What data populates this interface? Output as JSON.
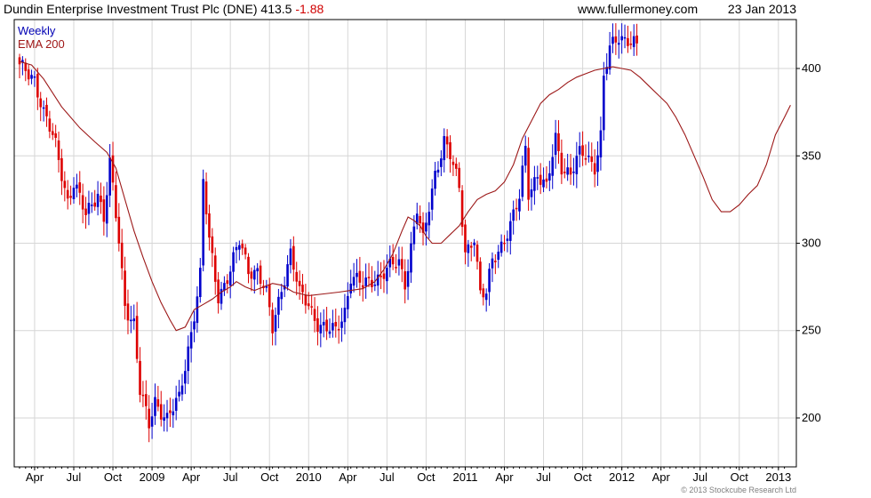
{
  "header": {
    "title_main": "Dundin Enterprise Investment Trust Plc (DNE) 413.5 ",
    "change": "-1.88",
    "site": "www.fullermoney.com",
    "date": "23 Jan 2013"
  },
  "footer": {
    "copyright": "© 2013 Stockcube Research Ltd"
  },
  "chart_data": {
    "type": "candlestick",
    "ylim": [
      172,
      428
    ],
    "y_ticks": [
      200,
      250,
      300,
      350,
      400
    ],
    "y_tick_labels": [
      "200",
      "250",
      "300",
      "350",
      "400"
    ],
    "x_tick_labels": [
      "Apr",
      "Jul",
      "Oct",
      "2009",
      "Apr",
      "Jul",
      "Oct",
      "2010",
      "Apr",
      "Jul",
      "Oct",
      "2011",
      "Apr",
      "Jul",
      "Oct",
      "2012",
      "Apr",
      "Jul",
      "Oct",
      "2013"
    ],
    "x_tick_weeks": [
      5,
      18,
      31,
      44,
      57,
      70,
      83,
      96,
      109,
      122,
      135,
      148,
      161,
      174,
      187,
      200,
      213,
      226,
      239,
      252
    ],
    "total_weeks": 256,
    "grid": true,
    "legend": {
      "position": "top-left",
      "entries": [
        "Weekly",
        "EMA 200"
      ]
    },
    "colors": {
      "up": "#0000cc",
      "down": "#dd0000",
      "ema": "#9c1818",
      "grid": "#d6d6d6"
    },
    "series": [
      {
        "name": "Weekly",
        "kind": "close_anchors",
        "points": [
          [
            0,
            400
          ],
          [
            5,
            395
          ],
          [
            8,
            375
          ],
          [
            12,
            355
          ],
          [
            16,
            325
          ],
          [
            18,
            335
          ],
          [
            22,
            315
          ],
          [
            26,
            330
          ],
          [
            28,
            315
          ],
          [
            30,
            345
          ],
          [
            33,
            300
          ],
          [
            35,
            265
          ],
          [
            38,
            255
          ],
          [
            40,
            215
          ],
          [
            43,
            195
          ],
          [
            45,
            210
          ],
          [
            49,
            200
          ],
          [
            53,
            210
          ],
          [
            57,
            250
          ],
          [
            60,
            282
          ],
          [
            61,
            335
          ],
          [
            63,
            300
          ],
          [
            66,
            270
          ],
          [
            70,
            285
          ],
          [
            73,
            300
          ],
          [
            76,
            285
          ],
          [
            79,
            285
          ],
          [
            82,
            270
          ],
          [
            84,
            250
          ],
          [
            87,
            275
          ],
          [
            90,
            295
          ],
          [
            93,
            270
          ],
          [
            96,
            265
          ],
          [
            99,
            255
          ],
          [
            102,
            250
          ],
          [
            105,
            249
          ],
          [
            108,
            262
          ],
          [
            110,
            282
          ],
          [
            114,
            275
          ],
          [
            118,
            280
          ],
          [
            122,
            285
          ],
          [
            126,
            288
          ],
          [
            128,
            278
          ],
          [
            132,
            320
          ],
          [
            134,
            300
          ],
          [
            138,
            340
          ],
          [
            141,
            360
          ],
          [
            143,
            350
          ],
          [
            146,
            330
          ],
          [
            148,
            295
          ],
          [
            151,
            305
          ],
          [
            153,
            270
          ],
          [
            155,
            270
          ],
          [
            157,
            290
          ],
          [
            160,
            300
          ],
          [
            163,
            310
          ],
          [
            166,
            325
          ],
          [
            168,
            355
          ],
          [
            169,
            330
          ],
          [
            172,
            340
          ],
          [
            175,
            330
          ],
          [
            178,
            360
          ],
          [
            180,
            345
          ],
          [
            183,
            340
          ],
          [
            186,
            350
          ],
          [
            188,
            350
          ],
          [
            191,
            345
          ],
          [
            193,
            362
          ],
          [
            194,
            395
          ],
          [
            196,
            410
          ],
          [
            199,
            418
          ],
          [
            202,
            418
          ],
          [
            204,
            415
          ],
          [
            205,
            412
          ]
        ]
      },
      {
        "name": "EMA 200",
        "kind": "line",
        "points": [
          [
            0,
            404
          ],
          [
            4,
            402
          ],
          [
            8,
            394
          ],
          [
            14,
            378
          ],
          [
            20,
            366
          ],
          [
            25,
            358
          ],
          [
            29,
            352
          ],
          [
            32,
            343
          ],
          [
            35,
            325
          ],
          [
            38,
            307
          ],
          [
            41,
            292
          ],
          [
            44,
            278
          ],
          [
            47,
            266
          ],
          [
            50,
            256
          ],
          [
            52,
            250
          ],
          [
            55,
            252
          ],
          [
            58,
            262
          ],
          [
            61,
            265
          ],
          [
            64,
            268
          ],
          [
            67,
            272
          ],
          [
            70,
            275
          ],
          [
            72,
            278
          ],
          [
            75,
            275
          ],
          [
            78,
            273
          ],
          [
            81,
            275
          ],
          [
            84,
            277
          ],
          [
            87,
            276
          ],
          [
            91,
            272
          ],
          [
            96,
            270
          ],
          [
            101,
            271
          ],
          [
            106,
            272
          ],
          [
            110,
            273
          ],
          [
            114,
            274
          ],
          [
            118,
            278
          ],
          [
            121,
            285
          ],
          [
            124,
            294
          ],
          [
            127,
            307
          ],
          [
            129,
            315
          ],
          [
            131,
            313
          ],
          [
            133,
            310
          ],
          [
            135,
            304
          ],
          [
            137,
            300
          ],
          [
            140,
            300
          ],
          [
            143,
            305
          ],
          [
            146,
            310
          ],
          [
            149,
            318
          ],
          [
            152,
            325
          ],
          [
            155,
            328
          ],
          [
            158,
            330
          ],
          [
            161,
            335
          ],
          [
            164,
            345
          ],
          [
            167,
            360
          ],
          [
            170,
            370
          ],
          [
            173,
            380
          ],
          [
            176,
            385
          ],
          [
            179,
            388
          ],
          [
            182,
            392
          ],
          [
            185,
            395
          ],
          [
            188,
            397
          ],
          [
            191,
            399
          ],
          [
            194,
            400
          ],
          [
            197,
            401
          ],
          [
            200,
            400
          ],
          [
            203,
            399
          ],
          [
            206,
            395
          ],
          [
            209,
            390
          ],
          [
            212,
            385
          ],
          [
            215,
            380
          ],
          [
            218,
            372
          ],
          [
            221,
            362
          ],
          [
            224,
            350
          ],
          [
            227,
            338
          ],
          [
            230,
            325
          ],
          [
            233,
            318
          ],
          [
            236,
            318
          ],
          [
            239,
            322
          ],
          [
            242,
            328
          ],
          [
            245,
            333
          ],
          [
            248,
            345
          ],
          [
            251,
            362
          ],
          [
            254,
            372
          ],
          [
            256,
            379
          ]
        ]
      }
    ]
  }
}
